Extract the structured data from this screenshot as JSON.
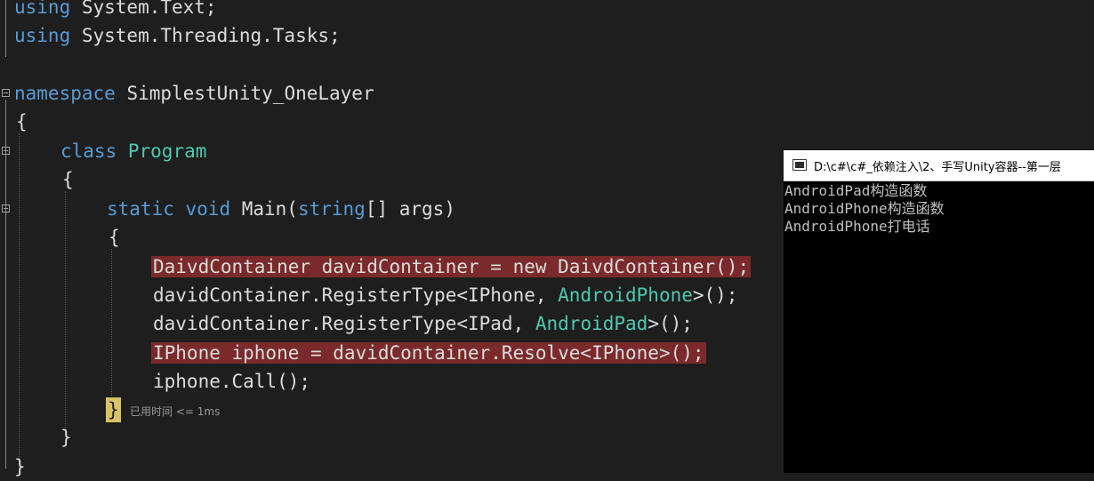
{
  "editor": {
    "lines": [
      {
        "id": "using-text",
        "parts": [
          {
            "t": "using",
            "c": "kw"
          },
          {
            "t": " System.Text;"
          }
        ]
      },
      {
        "id": "using-tasks",
        "parts": [
          {
            "t": "using",
            "c": "kw"
          },
          {
            "t": " System.Threading.Tasks;"
          }
        ]
      },
      {
        "id": "namespace",
        "parts": [
          {
            "t": "namespace",
            "c": "kw"
          },
          {
            "t": " SimplestUnity_OneLayer"
          }
        ]
      },
      {
        "id": "ns-open",
        "parts": [
          {
            "t": "{"
          }
        ]
      },
      {
        "id": "class",
        "parts": [
          {
            "t": "class",
            "c": "kw"
          },
          {
            "t": " "
          },
          {
            "t": "Program",
            "c": "type"
          }
        ]
      },
      {
        "id": "class-open",
        "parts": [
          {
            "t": "{"
          }
        ]
      },
      {
        "id": "main",
        "parts": [
          {
            "t": "static",
            "c": "kw"
          },
          {
            "t": " "
          },
          {
            "t": "void",
            "c": "kw"
          },
          {
            "t": " Main("
          },
          {
            "t": "string",
            "c": "kw"
          },
          {
            "t": "[] args)"
          }
        ]
      },
      {
        "id": "main-open",
        "parts": [
          {
            "t": "{"
          }
        ]
      },
      {
        "id": "stmt-new",
        "highlight": true,
        "parts": [
          {
            "t": "DaivdContainer davidContainer = new DaivdContainer();"
          }
        ]
      },
      {
        "id": "stmt-reg-phone",
        "parts": [
          {
            "t": "davidContainer.RegisterType<IPhone, "
          },
          {
            "t": "AndroidPhone",
            "c": "type"
          },
          {
            "t": ">();"
          }
        ]
      },
      {
        "id": "stmt-reg-pad",
        "parts": [
          {
            "t": "davidContainer.RegisterType<IPad, "
          },
          {
            "t": "AndroidPad",
            "c": "type"
          },
          {
            "t": ">();"
          }
        ]
      },
      {
        "id": "stmt-resolve",
        "highlight": true,
        "parts": [
          {
            "t": "IPhone iphone = davidContainer.Resolve<IPhone>();"
          }
        ]
      },
      {
        "id": "stmt-call",
        "parts": [
          {
            "t": "iphone.Call();"
          }
        ]
      },
      {
        "id": "class-close",
        "parts": [
          {
            "t": "}"
          }
        ]
      },
      {
        "id": "ns-close",
        "parts": [
          {
            "t": "}"
          }
        ]
      }
    ],
    "brace_match": "}",
    "perf_tip": "已用时间 <= 1ms"
  },
  "console": {
    "title": "D:\\c#\\c#_依赖注入\\2、手写Unity容器--第一层",
    "output": [
      "AndroidPad构造函数",
      "AndroidPhone构造函数",
      "AndroidPhone打电话"
    ]
  },
  "colors": {
    "background": "#1e1e1e",
    "keyword": "#569cd6",
    "type": "#4ec9b0",
    "text": "#dcdcdc",
    "breakpoint_highlight": "#7a2a2a",
    "brace_highlight": "#d7c46a"
  }
}
